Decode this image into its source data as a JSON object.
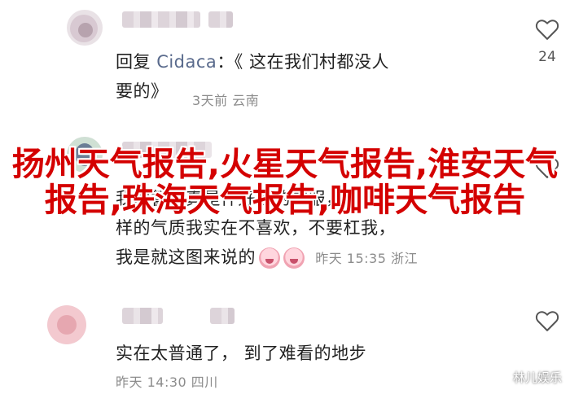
{
  "comments": [
    {
      "reply_prefix": "回复",
      "reply_user": "Cidaca",
      "text_line1": "：《 这在我们村都没人",
      "text_line2": "要的》",
      "meta": "3天前  云南",
      "likes": "24"
    },
    {
      "text_line1": "我发誓这真是件好看的衣服，这",
      "text_line2": "样的气质我实在不喜欢，不要杠我，",
      "text_line3": "我是就这图来说的",
      "meta": "昨天 15:35 浙江",
      "likes": ""
    },
    {
      "text_line1": "实在太普通了，  到了难看的地步",
      "meta": "昨天 14:30 四川",
      "likes": ""
    }
  ],
  "headline": "扬州天气报告,火星天气报告,淮安天气报告,珠海天气报告,咖啡天气报告",
  "watermark": "林儿娱乐",
  "colors": {
    "headline": "#d40000",
    "reply_user": "#596a8c",
    "meta": "#8c8c8c"
  },
  "icons": [
    "heart-outline-icon",
    "emoji-icon"
  ]
}
